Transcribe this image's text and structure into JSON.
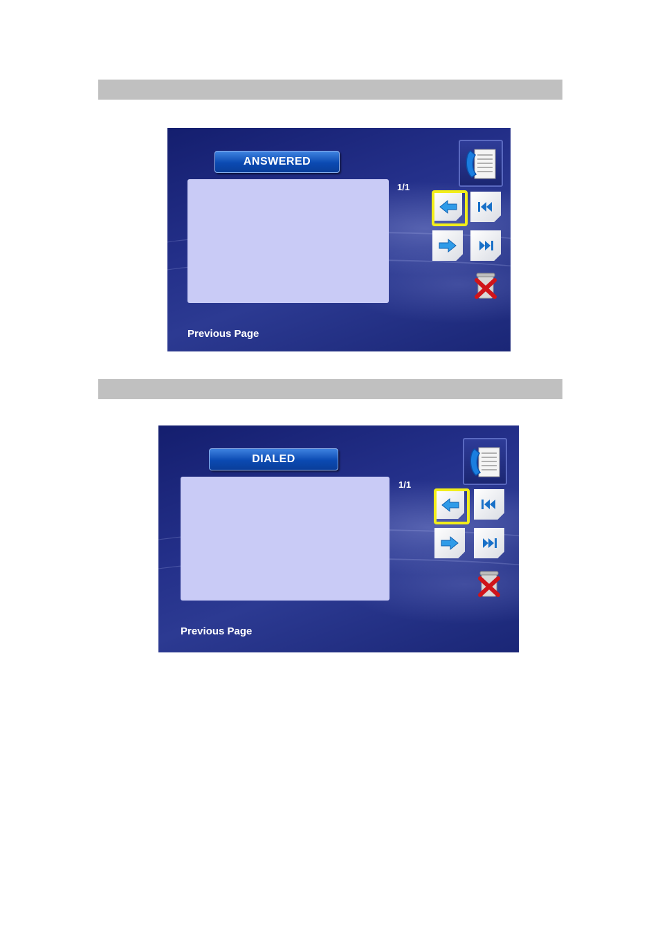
{
  "screens": [
    {
      "title": "ANSWERED",
      "page_count": "1/1",
      "footer": "Previous Page"
    },
    {
      "title": "DIALED",
      "page_count": "1/1",
      "footer": "Previous Page"
    }
  ],
  "icons": {
    "phonebook": "phonebook-icon",
    "back": "back-arrow-icon",
    "first": "first-page-icon",
    "next": "next-arrow-icon",
    "last": "last-page-icon",
    "delete": "trash-delete-icon"
  },
  "colors": {
    "highlight": "#f2ee1a",
    "panel": "#c9cbf6",
    "button": "#0b4ab2"
  }
}
